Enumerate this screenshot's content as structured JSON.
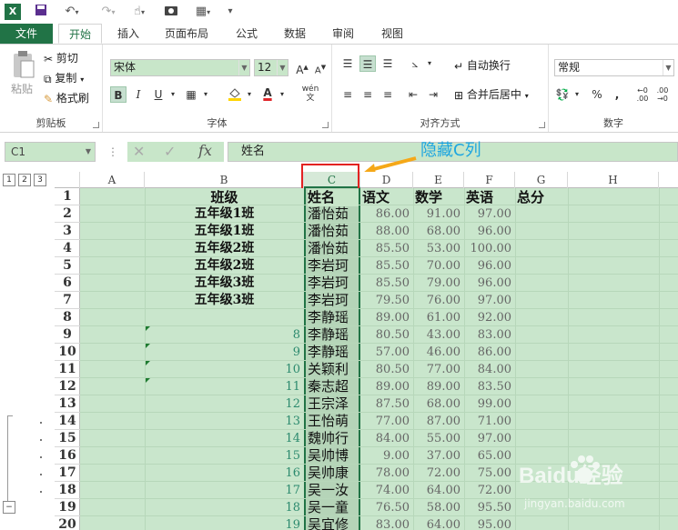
{
  "app": {
    "logo": "excel-logo-icon"
  },
  "quick_access": {
    "icons": [
      "save-icon",
      "undo-icon",
      "redo-icon",
      "touch-mode-icon",
      "camera-icon",
      "form-icon",
      "customize-icon"
    ]
  },
  "tabs": [
    "文件",
    "开始",
    "插入",
    "页面布局",
    "公式",
    "数据",
    "审阅",
    "视图"
  ],
  "ribbon": {
    "clipboard": {
      "label": "剪贴板",
      "paste": "粘贴",
      "cut": "剪切",
      "copy": "复制",
      "format_painter": "格式刷"
    },
    "font": {
      "label": "字体",
      "family": "宋体",
      "size": "12"
    },
    "alignment": {
      "label": "对齐方式",
      "wrap": "自动换行",
      "merge": "合并后居中"
    },
    "number": {
      "label": "数字",
      "format": "常规"
    }
  },
  "formula_bar": {
    "name_box": "C1",
    "fx": "fx",
    "value": "姓名"
  },
  "annotation": {
    "text": "隐藏C列",
    "color": "#1ea6e0"
  },
  "outline": {
    "levels": [
      "1",
      "2",
      "3"
    ],
    "collapse": "−"
  },
  "columns": [
    "A",
    "B",
    "C",
    "D",
    "E",
    "F",
    "G",
    "H"
  ],
  "headers": {
    "name": "姓名",
    "chinese": "语文",
    "math": "数学",
    "english": "英语",
    "total": "总分",
    "class": "班级"
  },
  "rows": [
    {
      "n": "2",
      "b": "五年级1班",
      "c": "潘怡茹",
      "d": "86.00",
      "e": "91.00",
      "f": "97.00"
    },
    {
      "n": "3",
      "b": "五年级1班",
      "c": "潘怡茹",
      "d": "88.00",
      "e": "68.00",
      "f": "96.00"
    },
    {
      "n": "4",
      "b": "五年级2班",
      "c": "潘怡茹",
      "d": "85.50",
      "e": "53.00",
      "f": "100.00"
    },
    {
      "n": "5",
      "b": "五年级2班",
      "c": "李岩珂",
      "d": "85.50",
      "e": "70.00",
      "f": "96.00"
    },
    {
      "n": "6",
      "b": "五年级3班",
      "c": "李岩珂",
      "d": "85.50",
      "e": "79.00",
      "f": "96.00"
    },
    {
      "n": "7",
      "b": "五年级3班",
      "c": "李岩珂",
      "d": "79.50",
      "e": "76.00",
      "f": "97.00"
    },
    {
      "n": "8",
      "b": "",
      "c": "李静瑶",
      "d": "89.00",
      "e": "61.00",
      "f": "92.00"
    },
    {
      "n": "9",
      "b": "8",
      "c": "李静瑶",
      "d": "80.50",
      "e": "43.00",
      "f": "83.00"
    },
    {
      "n": "10",
      "b": "9",
      "c": "李静瑶",
      "d": "57.00",
      "e": "46.00",
      "f": "86.00"
    },
    {
      "n": "11",
      "b": "10",
      "c": "关颖利",
      "d": "80.50",
      "e": "77.00",
      "f": "84.00"
    },
    {
      "n": "12",
      "b": "11",
      "c": "秦志超",
      "d": "89.00",
      "e": "89.00",
      "f": "83.50"
    },
    {
      "n": "13",
      "b": "12",
      "c": "王宗泽",
      "d": "87.50",
      "e": "68.00",
      "f": "99.00"
    },
    {
      "n": "14",
      "b": "13",
      "c": "王怡萌",
      "d": "77.00",
      "e": "87.00",
      "f": "71.00"
    },
    {
      "n": "15",
      "b": "14",
      "c": "魏帅行",
      "d": "84.00",
      "e": "55.00",
      "f": "97.00"
    },
    {
      "n": "16",
      "b": "15",
      "c": "吴帅博",
      "d": "9.00",
      "e": "37.00",
      "f": "65.00"
    },
    {
      "n": "17",
      "b": "16",
      "c": "吴帅康",
      "d": "78.00",
      "e": "72.00",
      "f": "75.00"
    },
    {
      "n": "18",
      "b": "17",
      "c": "吴一汝",
      "d": "74.00",
      "e": "64.00",
      "f": "72.00"
    },
    {
      "n": "19",
      "b": "18",
      "c": "吴一童",
      "d": "76.50",
      "e": "58.00",
      "f": "95.50"
    },
    {
      "n": "20",
      "b": "19",
      "c": "吴宜修",
      "d": "83.00",
      "e": "64.00",
      "f": "95.00"
    }
  ],
  "watermark": {
    "brand": "Baidu经验",
    "url": "jingyan.baidu.com"
  }
}
